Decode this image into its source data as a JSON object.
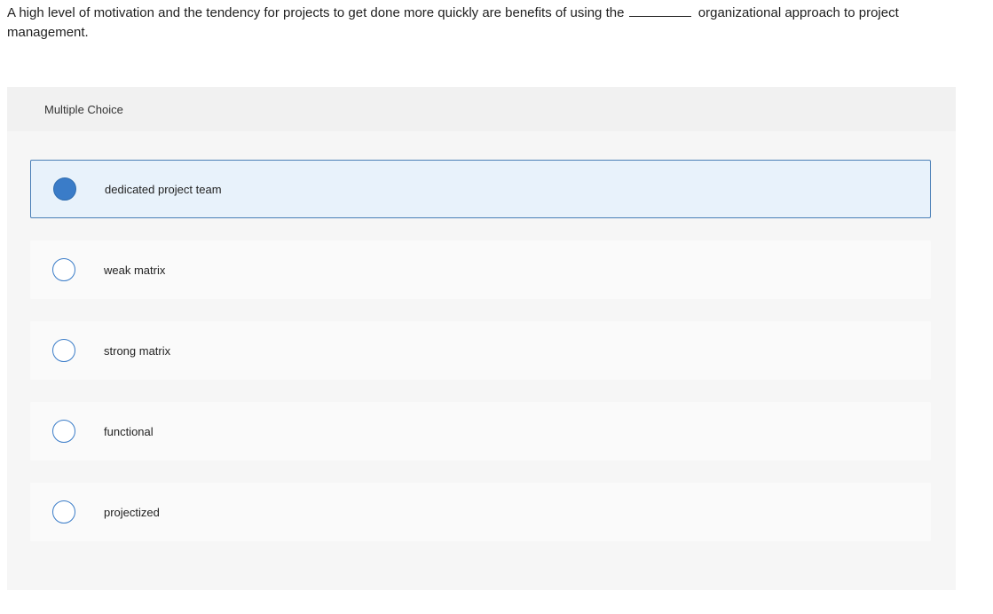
{
  "question": {
    "text_before": "A high level of motivation and the tendency for projects to get done more quickly are benefits of using the",
    "text_after": "organizational approach to project management."
  },
  "panel": {
    "header_label": "Multiple Choice"
  },
  "options": [
    {
      "label": "dedicated project team",
      "selected": true
    },
    {
      "label": "weak matrix",
      "selected": false
    },
    {
      "label": "strong matrix",
      "selected": false
    },
    {
      "label": "functional",
      "selected": false
    },
    {
      "label": "projectized",
      "selected": false
    }
  ],
  "colors": {
    "accent": "#3a7cc8",
    "selected_background": "#e8f2fb",
    "selected_border": "#4a7fb7",
    "panel_background": "#f6f6f6"
  }
}
